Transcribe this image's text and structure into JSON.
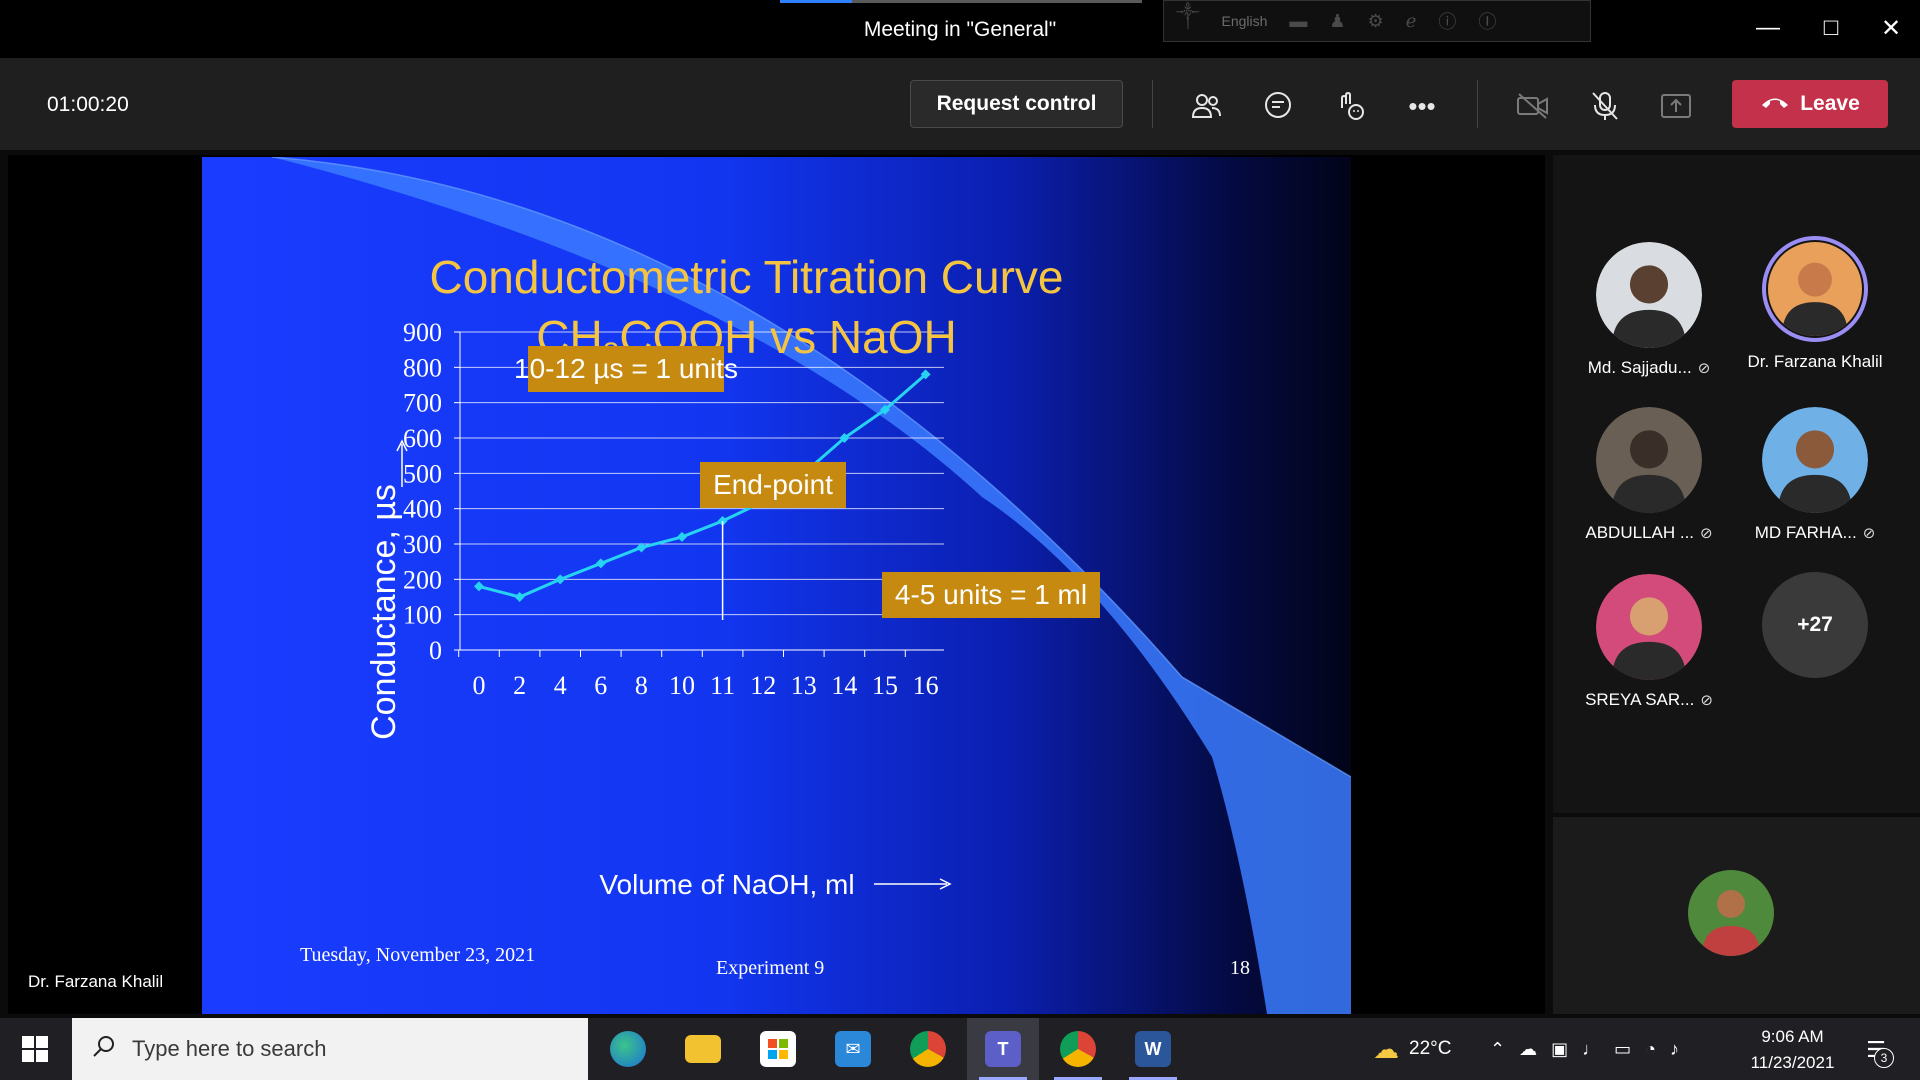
{
  "window": {
    "title": "Meeting in \"General\"",
    "language": "English"
  },
  "meeting": {
    "timer": "01:00:20",
    "request_control_label": "Request control",
    "leave_label": "Leave"
  },
  "stage": {
    "presenter_name": "Dr. Farzana Khalil"
  },
  "slide": {
    "title_line1": "Conductometric Titration Curve",
    "title_line2_pre": "CH",
    "title_line2_sub": "3",
    "title_line2_post": "COOH vs NaOH",
    "annotation_units": "10-12 µs = 1 units",
    "annotation_endpoint": "End-point",
    "annotation_ml": "4-5 units = 1 ml",
    "footer_date": "Tuesday, November 23, 2021",
    "footer_experiment": "Experiment 9",
    "footer_page": "18"
  },
  "chart_data": {
    "type": "line",
    "xlabel": "Volume of NaOH, ml",
    "ylabel": "Conductance, µs",
    "x_ticks": [
      "0",
      "2",
      "4",
      "6",
      "8",
      "10",
      "11",
      "12",
      "13",
      "14",
      "15",
      "16"
    ],
    "y_ticks": [
      "0",
      "100",
      "200",
      "300",
      "400",
      "500",
      "600",
      "700",
      "800",
      "900"
    ],
    "ylim": [
      0,
      900
    ],
    "grid": true,
    "series": [
      {
        "points": [
          {
            "x": "0",
            "y": 180
          },
          {
            "x": "2",
            "y": 150
          },
          {
            "x": "4",
            "y": 200
          },
          {
            "x": "6",
            "y": 245
          },
          {
            "x": "8",
            "y": 290
          },
          {
            "x": "10",
            "y": 320
          },
          {
            "x": "11",
            "y": 365
          },
          {
            "x": "12",
            "y": 420
          },
          {
            "x": "13",
            "y": 500
          },
          {
            "x": "14",
            "y": 600
          },
          {
            "x": "15",
            "y": 680
          },
          {
            "x": "16",
            "y": 780
          }
        ]
      }
    ],
    "endpoint_x": "11"
  },
  "participants": [
    {
      "name": "Md. Sajjadu...",
      "muted": true,
      "color": "#d9dde2",
      "face": "#5a4030"
    },
    {
      "name": "Dr. Farzana Khalil",
      "muted": false,
      "speaking": true,
      "color": "#e9a05a",
      "face": "#c97a4a"
    },
    {
      "name": "ABDULLAH ...",
      "muted": true,
      "color": "#6a5f55",
      "face": "#3a2f28"
    },
    {
      "name": "MD FARHA...",
      "muted": true,
      "color": "#6fb0e6",
      "face": "#8a5a3a"
    },
    {
      "name": "SREYA SAR...",
      "muted": true,
      "color": "#d24b7a",
      "face": "#d8a070"
    }
  ],
  "more_participants": "+27",
  "taskbar": {
    "search_placeholder": "Type here to search",
    "weather": "22°C",
    "time": "9:06 AM",
    "date": "11/23/2021",
    "notification_count": "3"
  }
}
